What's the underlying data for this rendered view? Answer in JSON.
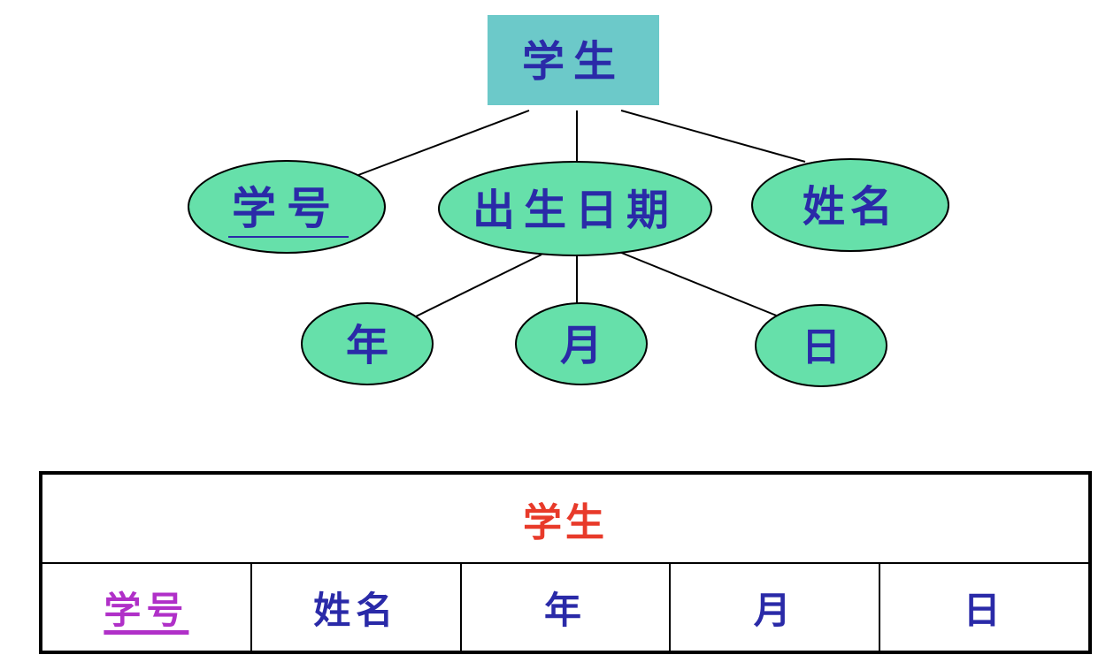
{
  "diagram": {
    "entity": {
      "label": "学生",
      "fill": "#6cc9c9"
    },
    "attr_color": "#66e0aa",
    "text_color": "#2a2aa8",
    "attributes": {
      "id": {
        "label": "学号",
        "underlined": true
      },
      "birthdate": {
        "label": "出生日期"
      },
      "name": {
        "label": "姓名"
      },
      "year": {
        "label": "年"
      },
      "month": {
        "label": "月"
      },
      "day": {
        "label": "日"
      }
    }
  },
  "table": {
    "title": "学生",
    "title_color": "#e83a2a",
    "key_color": "#b030c8",
    "columns": [
      {
        "label": "学号",
        "key": true
      },
      {
        "label": "姓名"
      },
      {
        "label": "年"
      },
      {
        "label": "月"
      },
      {
        "label": "日"
      }
    ]
  }
}
